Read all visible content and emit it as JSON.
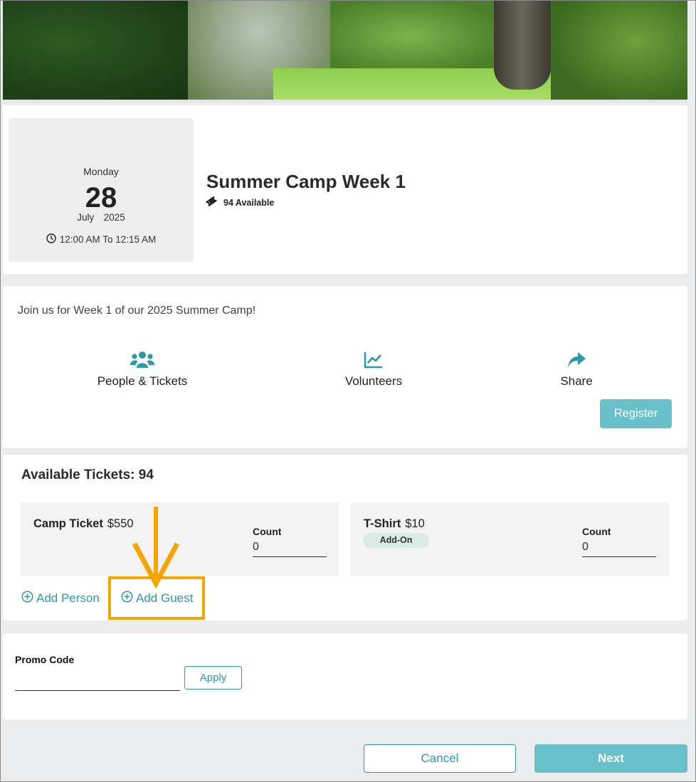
{
  "event": {
    "weekday": "Monday",
    "day": "28",
    "month_year": "July  2025",
    "time_range": "12:00 AM To 12:15 AM",
    "title": "Summer Camp Week 1",
    "availability": "94 Available"
  },
  "description": {
    "text": "Join us for Week 1 of our 2025 Summer Camp!",
    "actions": [
      {
        "label": "People & Tickets",
        "icon": "people-icon"
      },
      {
        "label": "Volunteers",
        "icon": "chart-line-icon"
      },
      {
        "label": "Share",
        "icon": "share-icon"
      }
    ],
    "register_label": "Register"
  },
  "tickets": {
    "heading": "Available Tickets: 94",
    "items": [
      {
        "name": "Camp Ticket",
        "price": "$550",
        "badge": "",
        "count_label": "Count",
        "count_value": "0"
      },
      {
        "name": "T-Shirt",
        "price": "$10",
        "badge": "Add-On",
        "count_label": "Count",
        "count_value": "0"
      }
    ],
    "add_person_label": "Add Person",
    "add_guest_label": "Add Guest"
  },
  "promo": {
    "label": "Promo Code",
    "value": "",
    "apply_label": "Apply"
  },
  "footer": {
    "cancel_label": "Cancel",
    "next_label": "Next"
  },
  "colors": {
    "accent": "#2a9aa5",
    "button_fill": "#68c1ca",
    "highlight": "#f5a400",
    "badge_fill": "#d8ece6"
  }
}
